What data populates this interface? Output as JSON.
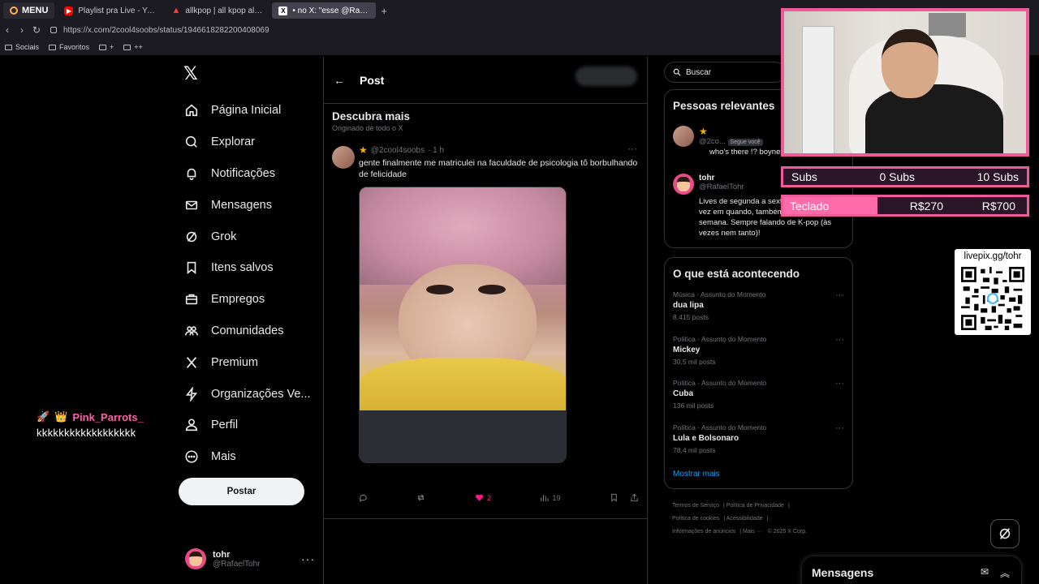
{
  "browser": {
    "menu_label": "MENU",
    "tabs": [
      {
        "title": "Playlist pra Live - YouTube"
      },
      {
        "title": "allkpop | all kpop all the time"
      },
      {
        "title": "• no X: \"esse @RafaelTohr\""
      }
    ],
    "url": "https://x.com/2cool4soobs/status/1946618282200408069",
    "bookmarks": [
      "Sociais",
      "Favoritos",
      "+",
      "++"
    ]
  },
  "nav": {
    "items": [
      {
        "label": "Página Inicial",
        "icon": "home-icon"
      },
      {
        "label": "Explorar",
        "icon": "search-icon"
      },
      {
        "label": "Notificações",
        "icon": "bell-icon"
      },
      {
        "label": "Mensagens",
        "icon": "mail-icon"
      },
      {
        "label": "Grok",
        "icon": "grok-icon"
      },
      {
        "label": "Itens salvos",
        "icon": "bookmark-icon"
      },
      {
        "label": "Empregos",
        "icon": "briefcase-icon"
      },
      {
        "label": "Comunidades",
        "icon": "people-icon"
      },
      {
        "label": "Premium",
        "icon": "x-icon"
      },
      {
        "label": "Organizações Ve...",
        "icon": "lightning-icon"
      },
      {
        "label": "Perfil",
        "icon": "person-icon"
      },
      {
        "label": "Mais",
        "icon": "more-circle-icon"
      }
    ],
    "post_button": "Postar",
    "account": {
      "name": "tohr",
      "handle": "@RafaelTohr"
    }
  },
  "chat": {
    "user": "Pink_Parrots_",
    "message": "kkkkkkkkkkkkkkkkkk"
  },
  "main": {
    "header_title": "Post",
    "discover_title": "Descubra mais",
    "discover_sub": "Originado de todo o X",
    "tweet": {
      "handle": "@2cool4soobs",
      "time": "· 1 h",
      "text": "gente finalmente me matriculei na faculdade de psicologia tô borbulhando de felicidade",
      "likes": "2",
      "views": "19"
    }
  },
  "search": {
    "placeholder": "Buscar"
  },
  "relevant": {
    "title": "Pessoas relevantes",
    "people": [
      {
        "handle": "@2co...",
        "follows_you": "Segue você",
        "bio": "who's there !? boynextdoor !!"
      },
      {
        "name": "tohr",
        "handle": "@RafaelTohr",
        "bio": "Lives de segunda a sexta, às 20h — e, de vez em quando, também no fim de semana. Sempre falando de K-pop (às vezes nem tanto)!"
      }
    ]
  },
  "trending": {
    "title": "O que está acontecendo",
    "items": [
      {
        "category": "Música · Assunto do Momento",
        "topic": "dua lipa",
        "count": "8.415 posts"
      },
      {
        "category": "Política · Assunto do Momento",
        "topic": "Mickey",
        "count": "30,5 mil posts"
      },
      {
        "category": "Política · Assunto do Momento",
        "topic": "Cuba",
        "count": "136 mil posts"
      },
      {
        "category": "Política · Assunto do Momento",
        "topic": "Lula e Bolsonaro",
        "count": "78,4 mil posts"
      }
    ],
    "show_more": "Mostrar mais"
  },
  "footer": {
    "links": [
      "Termos de Serviço",
      "Política de Privacidade",
      "Política de cookies",
      "Acessibilidade",
      "Informações de anúncios",
      "Mais ···",
      "© 2025 X Corp."
    ]
  },
  "messages_drawer": {
    "title": "Mensagens"
  },
  "overlay": {
    "subs": {
      "label": "Subs",
      "current": "0 Subs",
      "goal": "10 Subs"
    },
    "teclado": {
      "label": "Teclado",
      "current": "R$270",
      "goal": "R$700",
      "progress": 0.386
    },
    "livepix": "livepix.gg/tohr"
  },
  "colors": {
    "accent_pink": "#ee5a9a",
    "like_pink": "#f91880",
    "link_blue": "#1d9bf0"
  }
}
